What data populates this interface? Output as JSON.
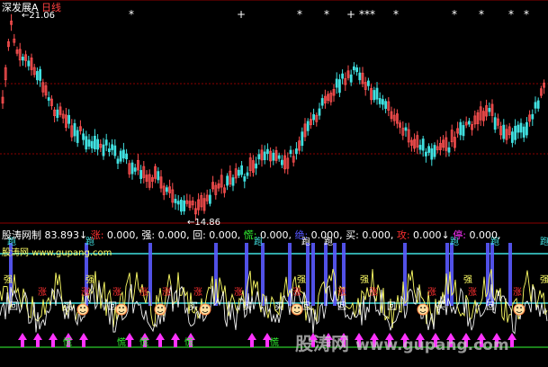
{
  "price_header": {
    "stock_name": "深发展A",
    "period": "日线"
  },
  "price_annotations": {
    "high": "21.06",
    "low": "14.86"
  },
  "indicator_header": {
    "name": "股涛网制",
    "value": "83.893↓",
    "fields": [
      {
        "label": "涨:",
        "value": "0.000,",
        "color": "#ff3030"
      },
      {
        "label": "强:",
        "value": "0.000,",
        "color": "#ffffff"
      },
      {
        "label": "回:",
        "value": "0.000,",
        "color": "#ffffff"
      },
      {
        "label": "慌:",
        "value": "0.000,",
        "color": "#33ff33"
      },
      {
        "label": "绝:",
        "value": "0.000,",
        "color": "#5555ff"
      },
      {
        "label": "买:",
        "value": "0.000,",
        "color": "#ffffff"
      },
      {
        "label": "攻:",
        "value": "0.000↓",
        "color": "#ff3030"
      },
      {
        "label": "停:",
        "value": "0.000,",
        "color": "#ff33ff"
      }
    ]
  },
  "signal_labels": {
    "run": "跑",
    "strong": "强",
    "rise": "涨",
    "back": "回",
    "buy": "买",
    "panic": "慌"
  },
  "signal_star": "*",
  "signal_plus": "+",
  "watermark": {
    "site_cn": "股涛网",
    "url_small": "www.gupang.com",
    "site_big_cn": "股涛网",
    "url_big": "www.gupang.com"
  },
  "colors": {
    "up": "#ff5050",
    "down": "#40e0e0",
    "grid": "#8b0000",
    "line_white": "#f0f0f0",
    "line_yellow": "#ffff66"
  }
}
